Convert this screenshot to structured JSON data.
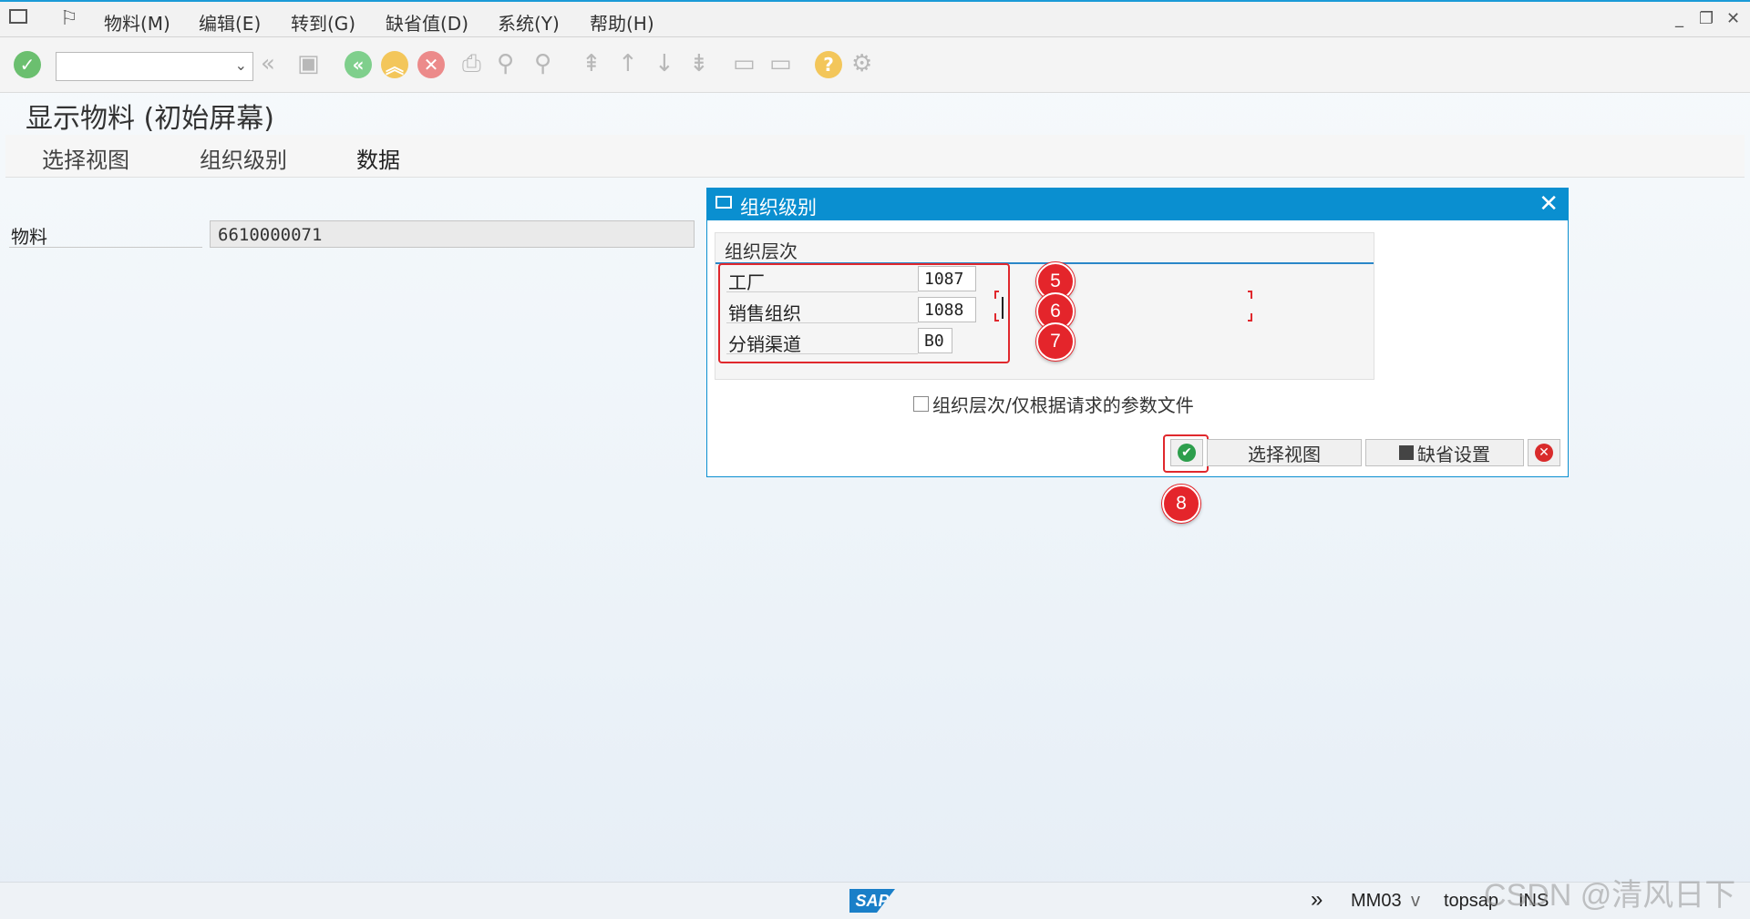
{
  "menu": [
    "物料(M)",
    "编辑(E)",
    "转到(G)",
    "缺省值(D)",
    "系统(Y)",
    "帮助(H)"
  ],
  "window_controls": [
    "_",
    "❐",
    "✕"
  ],
  "page_title": "显示物料 (初始屏幕)",
  "tabs": [
    "选择视图",
    "组织级别",
    "数据"
  ],
  "material": {
    "label": "物料",
    "value": "6610000071"
  },
  "dialog": {
    "title": "组织级别",
    "close": "✕",
    "group_title": "组织层次",
    "rows": [
      {
        "label": "工厂",
        "value": "1087"
      },
      {
        "label": "销售组织",
        "value": "1088"
      },
      {
        "label": "分销渠道",
        "value": "B0"
      }
    ],
    "checkbox_label": "组织层次/仅根据请求的参数文件",
    "buttons": {
      "ok": "✔",
      "select_views": "选择视图",
      "default_settings": "缺省设置",
      "cancel": "✕"
    }
  },
  "badges": [
    "5",
    "6",
    "7",
    "8"
  ],
  "status": {
    "logo": "SAP",
    "transaction": "MM03",
    "system": "topsap",
    "mode": "INS",
    "arrows": "»",
    "dropdown": "v"
  },
  "watermark": "CSDN @清风日下",
  "colors": {
    "header_blue": "#0a8fd0",
    "highlight_red": "#e4252b",
    "ok_green": "#2d9e4c"
  }
}
